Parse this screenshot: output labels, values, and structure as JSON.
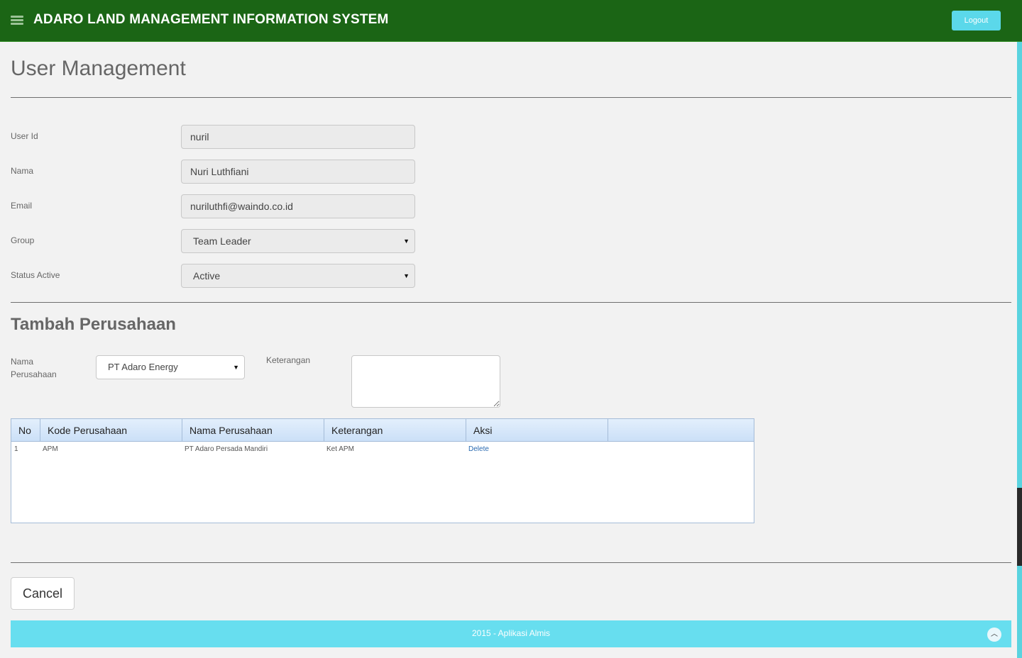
{
  "header": {
    "title": "ADARO LAND MANAGEMENT INFORMATION SYSTEM",
    "logout_label": "Logout",
    "menu_icon": "hamburger-icon",
    "bg_color": "#1b6515"
  },
  "page": {
    "title": "User Management"
  },
  "form": {
    "user_id": {
      "label": "User Id",
      "value": "nuril"
    },
    "nama": {
      "label": "Nama",
      "value": "Nuri Luthfiani"
    },
    "email": {
      "label": "Email",
      "value": "nuriluthfi@waindo.co.id"
    },
    "group": {
      "label": "Group",
      "value": "Team Leader"
    },
    "status": {
      "label": "Status Active",
      "value": "Active"
    }
  },
  "perusahaan": {
    "section_title": "Tambah Perusahaan",
    "nama_label_line1": "Nama",
    "nama_label_line2": "Perusahaan",
    "nama_value": "PT Adaro Energy",
    "keterangan_label": "Keterangan",
    "keterangan_value": ""
  },
  "table": {
    "columns": [
      "No",
      "Kode Perusahaan",
      "Nama Perusahaan",
      "Keterangan",
      "Aksi"
    ],
    "rows": [
      {
        "no": "1",
        "kode": "APM",
        "nama": "PT Adaro Persada Mandiri",
        "keterangan": "Ket APM",
        "aksi": "Delete"
      }
    ]
  },
  "actions": {
    "cancel_label": "Cancel"
  },
  "footer": {
    "text": "2015 - Aplikasi Almis",
    "scroll_top_icon": "chevron-up-icon",
    "bg_color": "#67deef"
  }
}
